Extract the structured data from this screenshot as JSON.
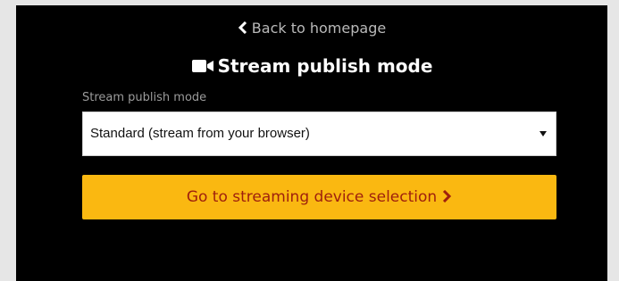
{
  "back_link": {
    "label": "Back to homepage",
    "icon": "chevron-left-icon"
  },
  "heading": {
    "title": "Stream publish mode",
    "icon": "video-camera-icon"
  },
  "publish_mode": {
    "label": "Stream publish mode",
    "selected": "Standard (stream from your browser)",
    "icon": "dropdown-arrow-icon"
  },
  "actions": {
    "go_label": "Go to streaming device selection",
    "go_icon": "chevron-right-icon"
  },
  "colors": {
    "background": "#000000",
    "accent": "#fab811",
    "button_text": "#9e1f0d",
    "muted_text": "#b9b9b9"
  }
}
